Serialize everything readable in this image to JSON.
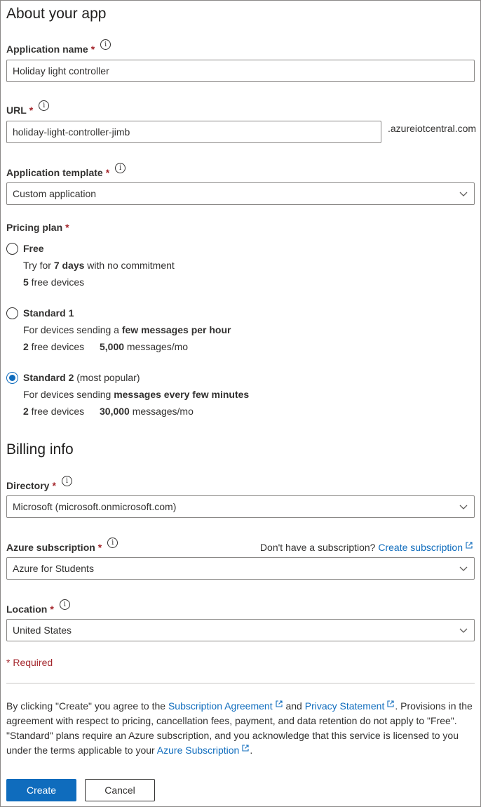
{
  "about": {
    "heading": "About your app",
    "app_name": {
      "label": "Application name",
      "required": "*",
      "info": "i",
      "value": "Holiday light controller"
    },
    "url": {
      "label": "URL",
      "required": "*",
      "info": "i",
      "value": "holiday-light-controller-jimb",
      "suffix": ".azureiotcentral.com"
    },
    "template": {
      "label": "Application template",
      "required": "*",
      "info": "i",
      "value": "Custom application"
    }
  },
  "pricing": {
    "label": "Pricing plan",
    "required": "*",
    "selected": "Standard 2",
    "plans": [
      {
        "title": "Free",
        "tag": "",
        "line1_pre": "Try for ",
        "line1_bold": "7 days",
        "line1_post": " with no commitment",
        "devices_count": "5",
        "devices_label": " free devices",
        "messages_count": "",
        "messages_label": ""
      },
      {
        "title": "Standard 1",
        "tag": "",
        "line1_pre": "For devices sending a ",
        "line1_bold": "few messages per hour",
        "line1_post": "",
        "devices_count": "2",
        "devices_label": " free devices",
        "messages_count": "5,000",
        "messages_label": " messages/mo"
      },
      {
        "title": "Standard 2",
        "tag": " (most popular)",
        "line1_pre": "For devices sending ",
        "line1_bold": "messages every few minutes",
        "line1_post": "",
        "devices_count": "2",
        "devices_label": " free devices",
        "messages_count": "30,000",
        "messages_label": " messages/mo"
      }
    ]
  },
  "billing": {
    "heading": "Billing info",
    "directory": {
      "label": "Directory",
      "required": "*",
      "info": "i",
      "value": "Microsoft (microsoft.onmicrosoft.com)"
    },
    "subscription": {
      "label": "Azure subscription",
      "required": "*",
      "info": "i",
      "value": "Azure for Students",
      "no_sub_text": "Don't have a subscription?",
      "create_link": "Create subscription"
    },
    "location": {
      "label": "Location",
      "required": "*",
      "info": "i",
      "value": "United States"
    }
  },
  "required_note": "* Required",
  "legal": {
    "p1": "By clicking \"Create\" you agree to the ",
    "link1": "Subscription Agreement",
    "p2": " and ",
    "link2": "Privacy Statement",
    "p3": ". Provisions in the agreement with respect to pricing, cancellation fees, payment, and data retention do not apply to \"Free\". \"Standard\" plans require an Azure subscription, and you acknowledge that this service is licensed to you under the terms applicable to your ",
    "link3": "Azure Subscription",
    "p4": "."
  },
  "actions": {
    "create": "Create",
    "cancel": "Cancel"
  },
  "icons": {
    "info": "info-circle-icon",
    "chevron": "chevron-down-icon",
    "external": "external-link-icon"
  },
  "colors": {
    "accent": "#0f6cbd",
    "required": "#a4262c",
    "text": "#323130",
    "border": "#8a8886"
  }
}
